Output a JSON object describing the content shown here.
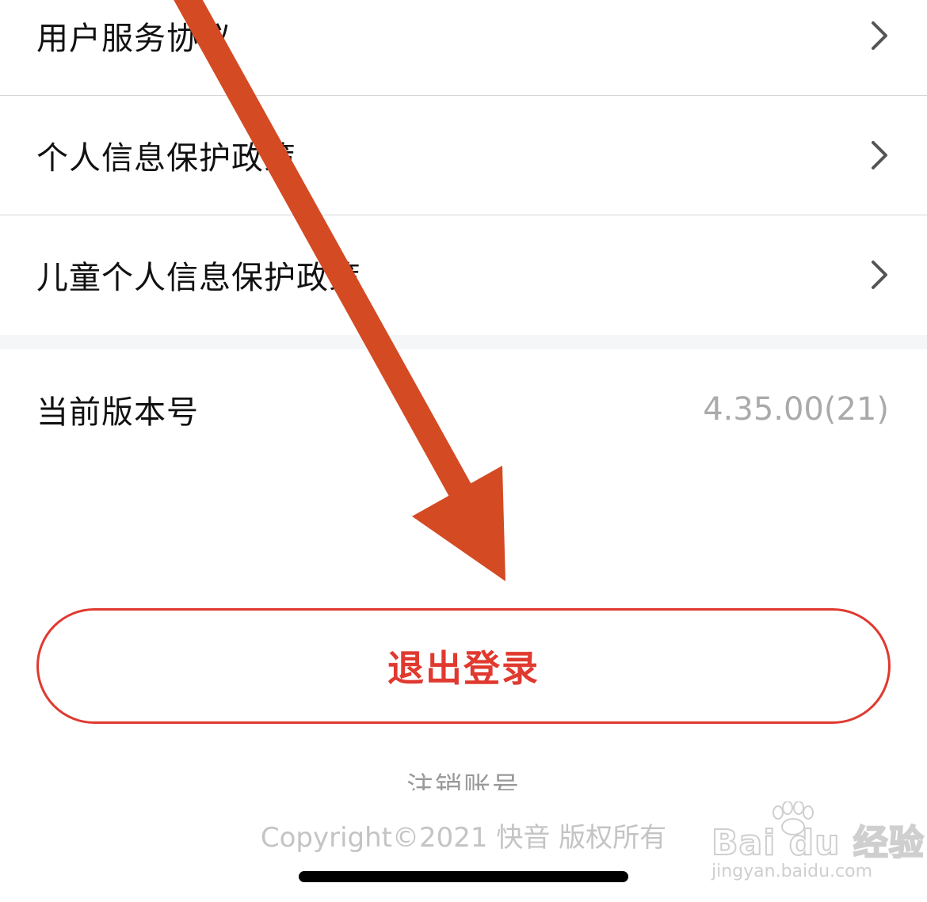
{
  "settings": {
    "items": [
      {
        "label": "用户服务协议"
      },
      {
        "label": "个人信息保护政策"
      },
      {
        "label": "儿童个人信息保护政策"
      }
    ],
    "version": {
      "label": "当前版本号",
      "value": "4.35.00(21)"
    }
  },
  "actions": {
    "logout_label": "退出登录",
    "cancel_account_label": "注销账号"
  },
  "footer": {
    "copyright": "Copyright©2021 快音 版权所有"
  },
  "watermark": {
    "brand": "Bai du 经验",
    "url": "jingyan.baidu.com"
  },
  "colors": {
    "accent": "#e0392f",
    "annotation_arrow": "#d44a22",
    "muted_text": "#aaaaaa",
    "divider": "#d6d6d6"
  },
  "icons": {
    "row_chevron": "chevron-right-icon"
  }
}
